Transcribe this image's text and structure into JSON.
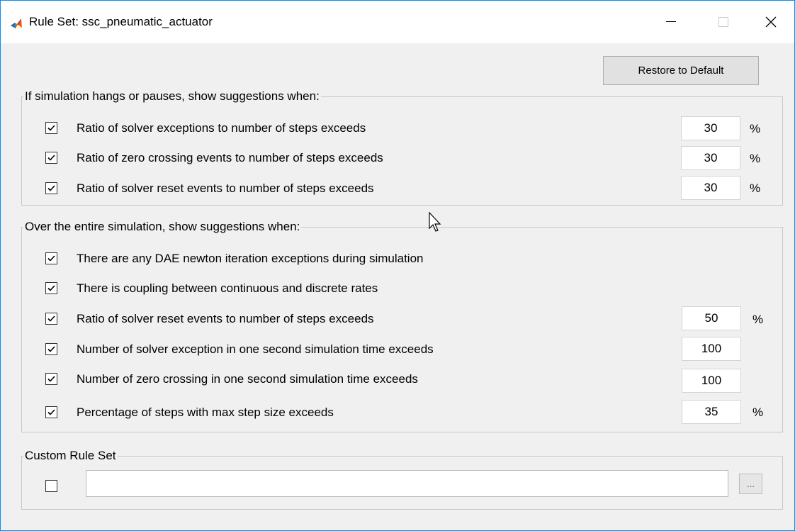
{
  "window": {
    "title": "Rule Set: ssc_pneumatic_actuator",
    "minimize_icon": "minimize-icon",
    "maximize_icon": "maximize-icon",
    "close_icon": "close-icon"
  },
  "restore_button": {
    "label": "Restore to Default"
  },
  "hangs_group": {
    "title": "If simulation hangs or pauses, show suggestions when:",
    "rows": [
      {
        "label": "Ratio of solver exceptions to number of steps exceeds",
        "checked": true,
        "value": "30",
        "unit": "%"
      },
      {
        "label": "Ratio of zero crossing events to number of steps exceeds",
        "checked": true,
        "value": "30",
        "unit": "%"
      },
      {
        "label": "Ratio of solver reset events to number of steps exceeds",
        "checked": true,
        "value": "30",
        "unit": "%"
      }
    ]
  },
  "entire_group": {
    "title": "Over the entire simulation, show suggestions when:",
    "rows": [
      {
        "label": "There are any DAE newton iteration exceptions during simulation",
        "checked": true
      },
      {
        "label": "There is coupling between continuous and discrete rates",
        "checked": true
      },
      {
        "label": "Ratio of solver reset events to number of steps exceeds",
        "checked": true,
        "value": "50",
        "unit": "%"
      },
      {
        "label": "Number of solver exception in one second simulation time exceeds",
        "checked": true,
        "value": "100"
      },
      {
        "label": "Number of zero crossing in one second simulation time exceeds",
        "checked": true,
        "value": "100"
      },
      {
        "label": "Percentage of steps with max step size exceeds",
        "checked": true,
        "value": "35",
        "unit": "%"
      }
    ]
  },
  "custom_group": {
    "title": "Custom Rule Set",
    "checked": false,
    "path_value": "",
    "browse_label": "..."
  },
  "colors": {
    "accent_border": "#3c7fb1",
    "background": "#f0f0f0"
  }
}
